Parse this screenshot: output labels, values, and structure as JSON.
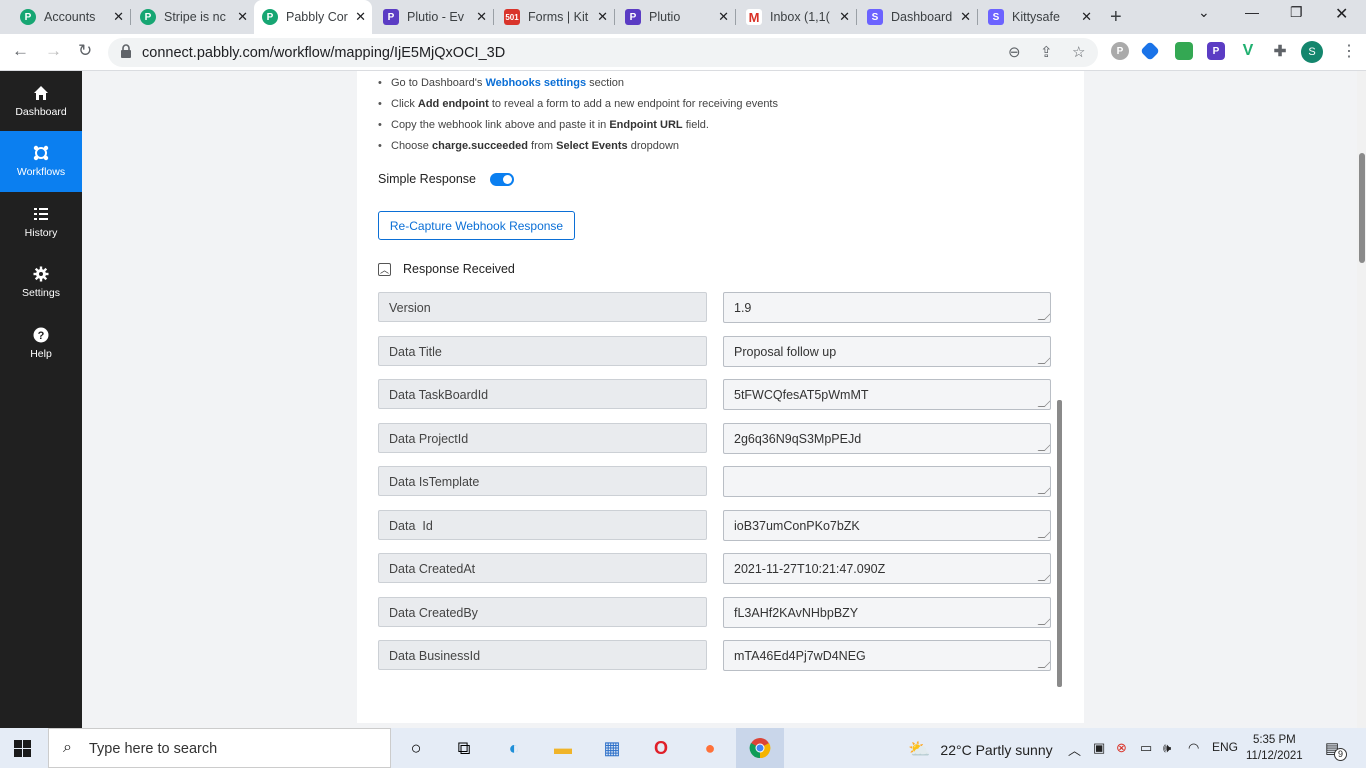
{
  "browser": {
    "tabs": [
      {
        "title": "Accounts",
        "favicon": "pabbly",
        "color": "#17a673",
        "active": false
      },
      {
        "title": "Stripe is nc",
        "favicon": "pabbly",
        "color": "#17a673",
        "active": false
      },
      {
        "title": "Pabbly Cor",
        "favicon": "pabbly",
        "color": "#17a673",
        "active": true
      },
      {
        "title": "Plutio - Ev",
        "favicon": "plutio",
        "color": "#5b3cc4",
        "active": false
      },
      {
        "title": "Forms | Kit",
        "favicon": "forms",
        "color": "#d9342b",
        "active": false
      },
      {
        "title": "Plutio",
        "favicon": "plutio",
        "color": "#5b3cc4",
        "active": false
      },
      {
        "title": "Inbox (1,1(",
        "favicon": "gmail",
        "color": "#d93025",
        "active": false
      },
      {
        "title": "Dashboard",
        "favicon": "s-app",
        "color": "#6c63ff",
        "active": false
      },
      {
        "title": "Kittysafe",
        "favicon": "s-app",
        "color": "#6c63ff",
        "active": false
      }
    ],
    "url": "connect.pabbly.com/workflow/mapping/IjE5MjQxOCI_3D",
    "profile_initial": "S"
  },
  "sidebar": {
    "items": [
      {
        "label": "Dashboard",
        "icon": "home-icon",
        "active": false
      },
      {
        "label": "Workflows",
        "icon": "workflow-icon",
        "active": true
      },
      {
        "label": "History",
        "icon": "history-icon",
        "active": false
      },
      {
        "label": "Settings",
        "icon": "gear-icon",
        "active": false
      },
      {
        "label": "Help",
        "icon": "help-icon",
        "active": false
      }
    ]
  },
  "instructions": {
    "step1": {
      "pre": "Go to Dashboard's ",
      "bold": "Webhooks settings",
      "post": " section"
    },
    "step2": {
      "pre": "Click ",
      "bold": "Add endpoint",
      "post": " to reveal a form to add a new endpoint for receiving events"
    },
    "step3": {
      "pre": "Copy the webhook link above and paste it in ",
      "bold": "Endpoint URL",
      "post": " field."
    },
    "step4": {
      "pre": "Choose ",
      "bold": "charge.succeeded",
      "mid": " from ",
      "bold2": "Select Events",
      "post": " dropdown"
    }
  },
  "simple_response": {
    "label": "Simple Response",
    "enabled": true
  },
  "recapture_button": "Re-Capture Webhook Response",
  "response": {
    "title": "Response Received",
    "fields": [
      {
        "label": "Version",
        "value": "1.9"
      },
      {
        "label": "Data Title",
        "value": "Proposal follow up"
      },
      {
        "label": "Data TaskBoardId",
        "value": "5tFWCQfesAT5pWmMT"
      },
      {
        "label": "Data ProjectId",
        "value": "2g6q36N9qS3MpPEJd"
      },
      {
        "label": "Data IsTemplate",
        "value": ""
      },
      {
        "label": "Data  Id",
        "value": "ioB37umConPKo7bZK"
      },
      {
        "label": "Data CreatedAt",
        "value": "2021-11-27T10:21:47.090Z"
      },
      {
        "label": "Data CreatedBy",
        "value": "fL3AHf2KAvNHbpBZY"
      },
      {
        "label": "Data BusinessId",
        "value": "mTA46Ed4Pj7wD4NEG"
      }
    ]
  },
  "taskbar": {
    "search_placeholder": "Type here to search",
    "weather": "22°C  Partly sunny",
    "language": "ENG",
    "time": "5:35 PM",
    "date": "11/12/2021",
    "notifications": "9"
  }
}
